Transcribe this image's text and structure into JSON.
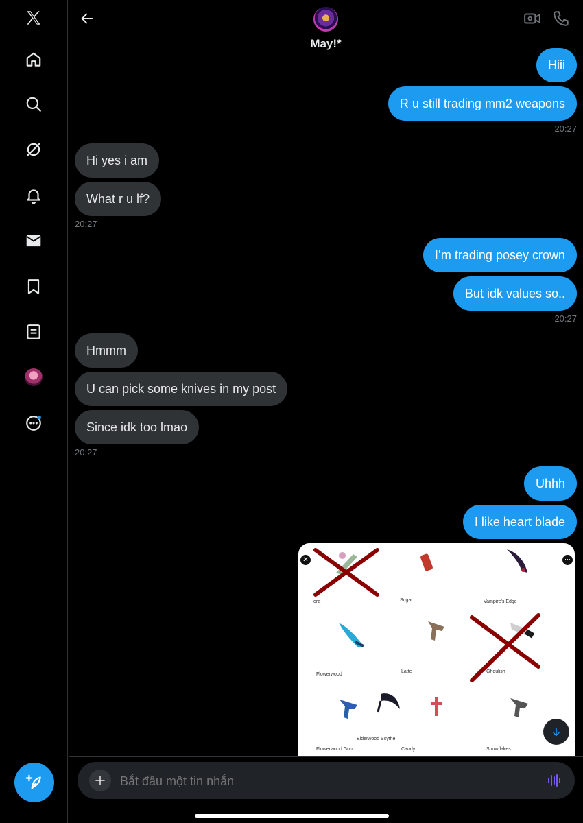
{
  "sidebar": {
    "items": [
      {
        "icon": "x-logo-icon"
      },
      {
        "icon": "home-icon"
      },
      {
        "icon": "search-icon"
      },
      {
        "icon": "grok-icon"
      },
      {
        "icon": "bell-icon"
      },
      {
        "icon": "mail-icon"
      },
      {
        "icon": "bookmark-icon"
      },
      {
        "icon": "lists-icon"
      },
      {
        "icon": "profile-avatar-icon"
      },
      {
        "icon": "more-icon"
      }
    ],
    "compose_icon": "feather-plus-icon",
    "notification_dot_color": "#1d9bf0"
  },
  "header": {
    "name": "May!*",
    "back_icon": "back-arrow-icon",
    "video_icon": "video-call-icon",
    "call_icon": "phone-icon"
  },
  "messages": [
    {
      "side": "sent",
      "text": "Hiii"
    },
    {
      "side": "sent",
      "text": "R u still trading mm2 weapons"
    },
    {
      "side": "sent_ts",
      "text": "20:27"
    },
    {
      "side": "recv",
      "text": "Hi yes i am"
    },
    {
      "side": "recv",
      "text": "What r u lf?"
    },
    {
      "side": "recv_ts",
      "text": "20:27"
    },
    {
      "side": "sent",
      "text": "I’m trading posey crown"
    },
    {
      "side": "sent",
      "text": "But idk values so.."
    },
    {
      "side": "sent_ts",
      "text": "20:27"
    },
    {
      "side": "recv",
      "text": "Hmmm"
    },
    {
      "side": "recv",
      "text": "U can pick some knives in my post"
    },
    {
      "side": "recv",
      "text": "Since idk too lmao"
    },
    {
      "side": "recv_ts",
      "text": "20:27"
    },
    {
      "side": "sent",
      "text": "Uhhh"
    },
    {
      "side": "sent",
      "text": "I like heart blade"
    }
  ],
  "media": {
    "labels": [
      "ora",
      "Sugar",
      "Vampire's Edge",
      "Flowerwood",
      "Latte",
      "Ghoulish",
      "Elderwood Scythe",
      "Flowerwood Gun",
      "Candy",
      "Snowflakes"
    ],
    "crossed_out": [
      "ora",
      "Ghoulish"
    ]
  },
  "composer": {
    "placeholder": "Bắt đầu một tin nhắn",
    "plus_icon": "plus-icon",
    "voice_icon": "voice-wave-icon"
  },
  "colors": {
    "accent": "#1d9bf0",
    "received_bubble": "#2f3336",
    "background": "#000000",
    "voice": "#7856ff"
  }
}
